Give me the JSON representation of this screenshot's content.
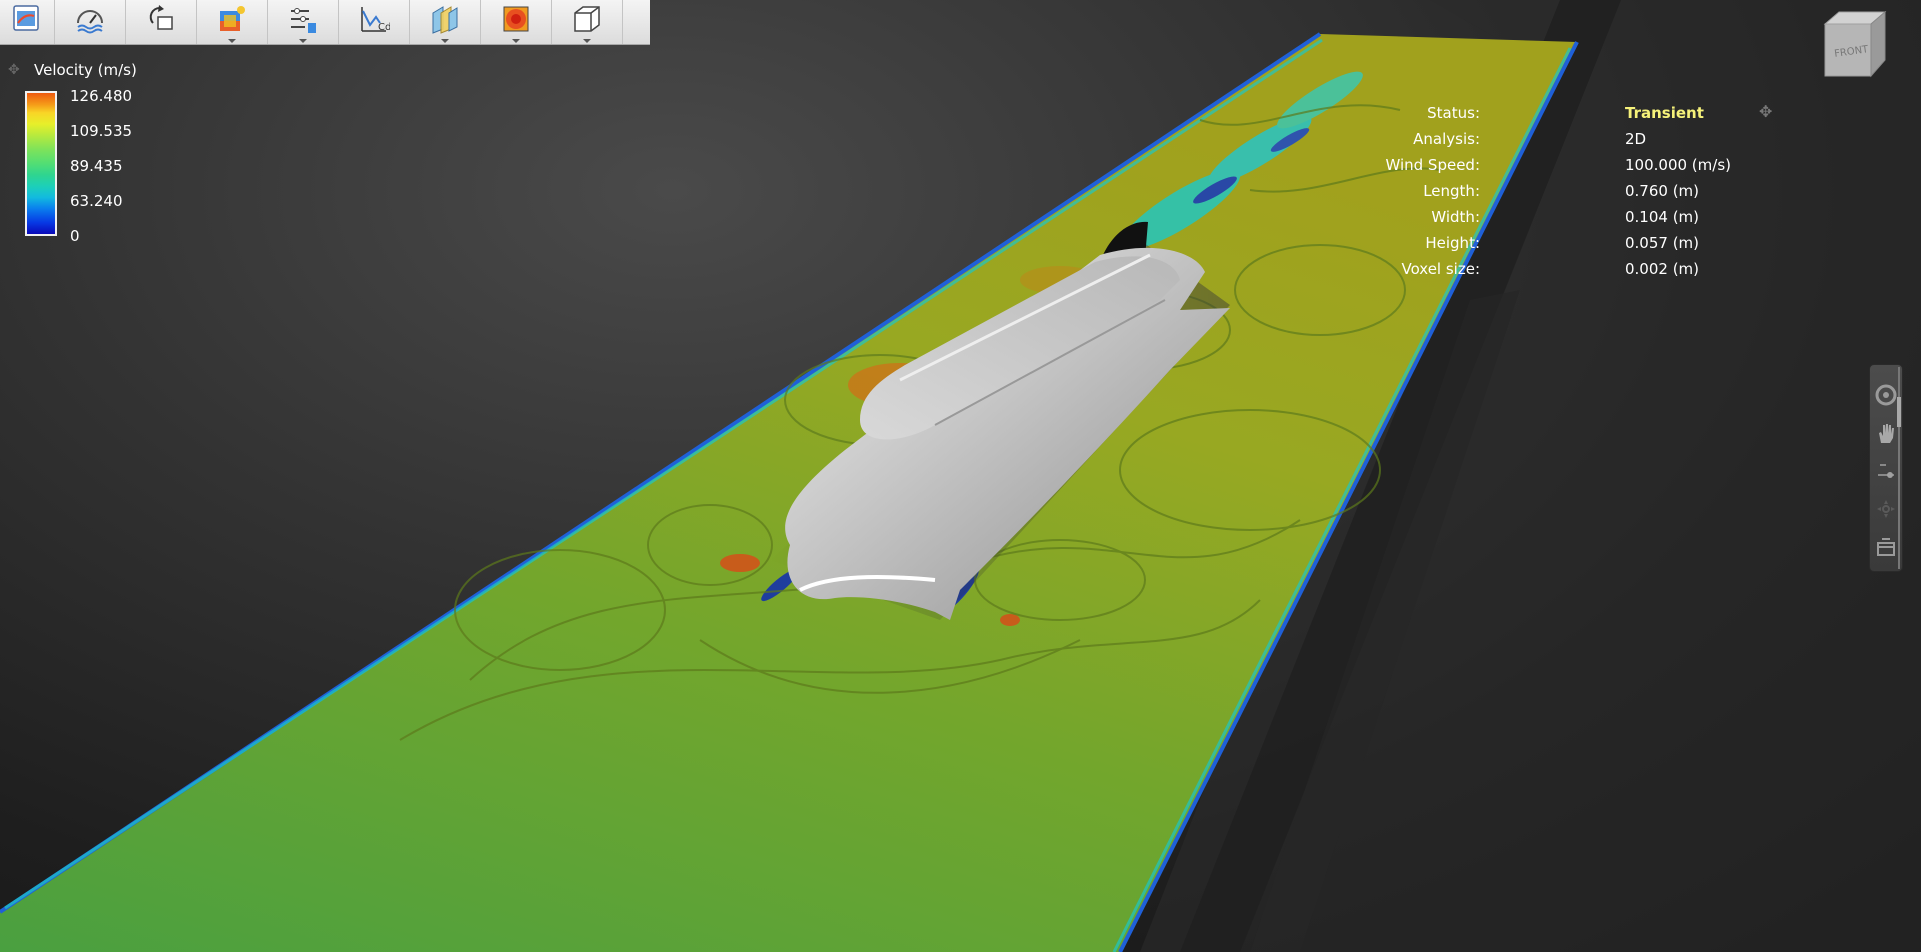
{
  "toolbar": {
    "tools": [
      {
        "icon": "results-icon",
        "dropdown": false
      },
      {
        "icon": "wind-speed-icon",
        "dropdown": false
      },
      {
        "icon": "rotate-model-icon",
        "dropdown": false
      },
      {
        "icon": "color-shaded-model-icon",
        "dropdown": true
      },
      {
        "icon": "settings-sliders-icon",
        "dropdown": true
      },
      {
        "icon": "cd-chart-icon",
        "dropdown": false
      },
      {
        "icon": "section-planes-icon",
        "dropdown": true
      },
      {
        "icon": "contour-plot-icon",
        "dropdown": true
      },
      {
        "icon": "display-box-icon",
        "dropdown": true
      }
    ]
  },
  "legend": {
    "title": "Velocity (m/s)",
    "ticks": [
      "126.480",
      "109.535",
      "89.435",
      "63.240",
      "0"
    ]
  },
  "info": {
    "status": {
      "label": "Status:",
      "value": "Transient"
    },
    "analysis": {
      "label": "Analysis:",
      "value": "2D"
    },
    "wind_speed": {
      "label": "Wind Speed:",
      "value": "100.000 (m/s)"
    },
    "length": {
      "label": "Length:",
      "value": "0.760 (m)"
    },
    "width": {
      "label": "Width:",
      "value": "0.104 (m)"
    },
    "height": {
      "label": "Height:",
      "value": "0.057 (m)"
    },
    "voxel_size": {
      "label": "Voxel size:",
      "value": "0.002 (m)"
    }
  },
  "viewcube": {
    "face_label": "FRONT"
  },
  "navbar": {
    "items": [
      "orbit-icon",
      "pan-hand-icon",
      "zoom-slider-icon",
      "look-around-icon",
      "fit-view-icon"
    ]
  },
  "colors": {
    "status_highlight": "#f6f27a",
    "plane_base": "#6aa830"
  }
}
